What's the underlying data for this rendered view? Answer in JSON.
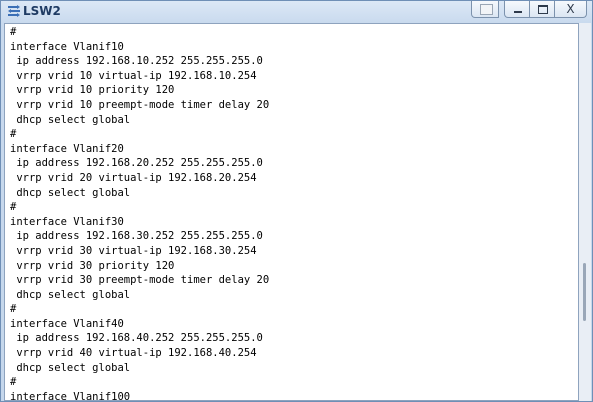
{
  "window": {
    "title": "LSW2",
    "controls": {
      "extra_icon": "window-menu-icon",
      "minimize_icon": "minimize-icon",
      "maximize_icon": "maximize-icon",
      "close_label": "X"
    }
  },
  "console": {
    "lines": [
      "#",
      "interface Vlanif10",
      " ip address 192.168.10.252 255.255.255.0",
      " vrrp vrid 10 virtual-ip 192.168.10.254",
      " vrrp vrid 10 priority 120",
      " vrrp vrid 10 preempt-mode timer delay 20",
      " dhcp select global",
      "#",
      "interface Vlanif20",
      " ip address 192.168.20.252 255.255.255.0",
      " vrrp vrid 20 virtual-ip 192.168.20.254",
      " dhcp select global",
      "#",
      "interface Vlanif30",
      " ip address 192.168.30.252 255.255.255.0",
      " vrrp vrid 30 virtual-ip 192.168.30.254",
      " vrrp vrid 30 priority 120",
      " vrrp vrid 30 preempt-mode timer delay 20",
      " dhcp select global",
      "#",
      "interface Vlanif40",
      " ip address 192.168.40.252 255.255.255.0",
      " vrrp vrid 40 virtual-ip 192.168.40.254",
      " dhcp select global",
      "#",
      "interface Vlanif100"
    ]
  },
  "colors": {
    "title_text": "#1f3b63",
    "console_bg": "#ffffff",
    "console_text": "#000000",
    "frame": "#c5d7ec"
  }
}
